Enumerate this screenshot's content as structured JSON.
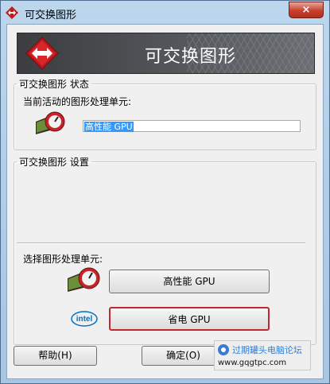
{
  "window": {
    "title": "可交换图形",
    "close_icon": "×"
  },
  "banner": {
    "title": "可交换图形"
  },
  "status_group": {
    "legend": "可交换图形 状态",
    "label": "当前活动的图形处理单元:",
    "current_gpu": "高性能 GPU"
  },
  "settings_group": {
    "legend": "可交换图形 设置",
    "select_label": "选择图形处理单元:",
    "high_perf_button": "高性能 GPU",
    "power_saving_button": "省电 GPU"
  },
  "footer": {
    "help_button": "帮助(H)",
    "ok_button": "确定(O)"
  },
  "watermark": {
    "title": "过期罐头电脑论坛",
    "url": "www.gqgtpc.com"
  },
  "icons": {
    "intel_logo": "intel"
  }
}
